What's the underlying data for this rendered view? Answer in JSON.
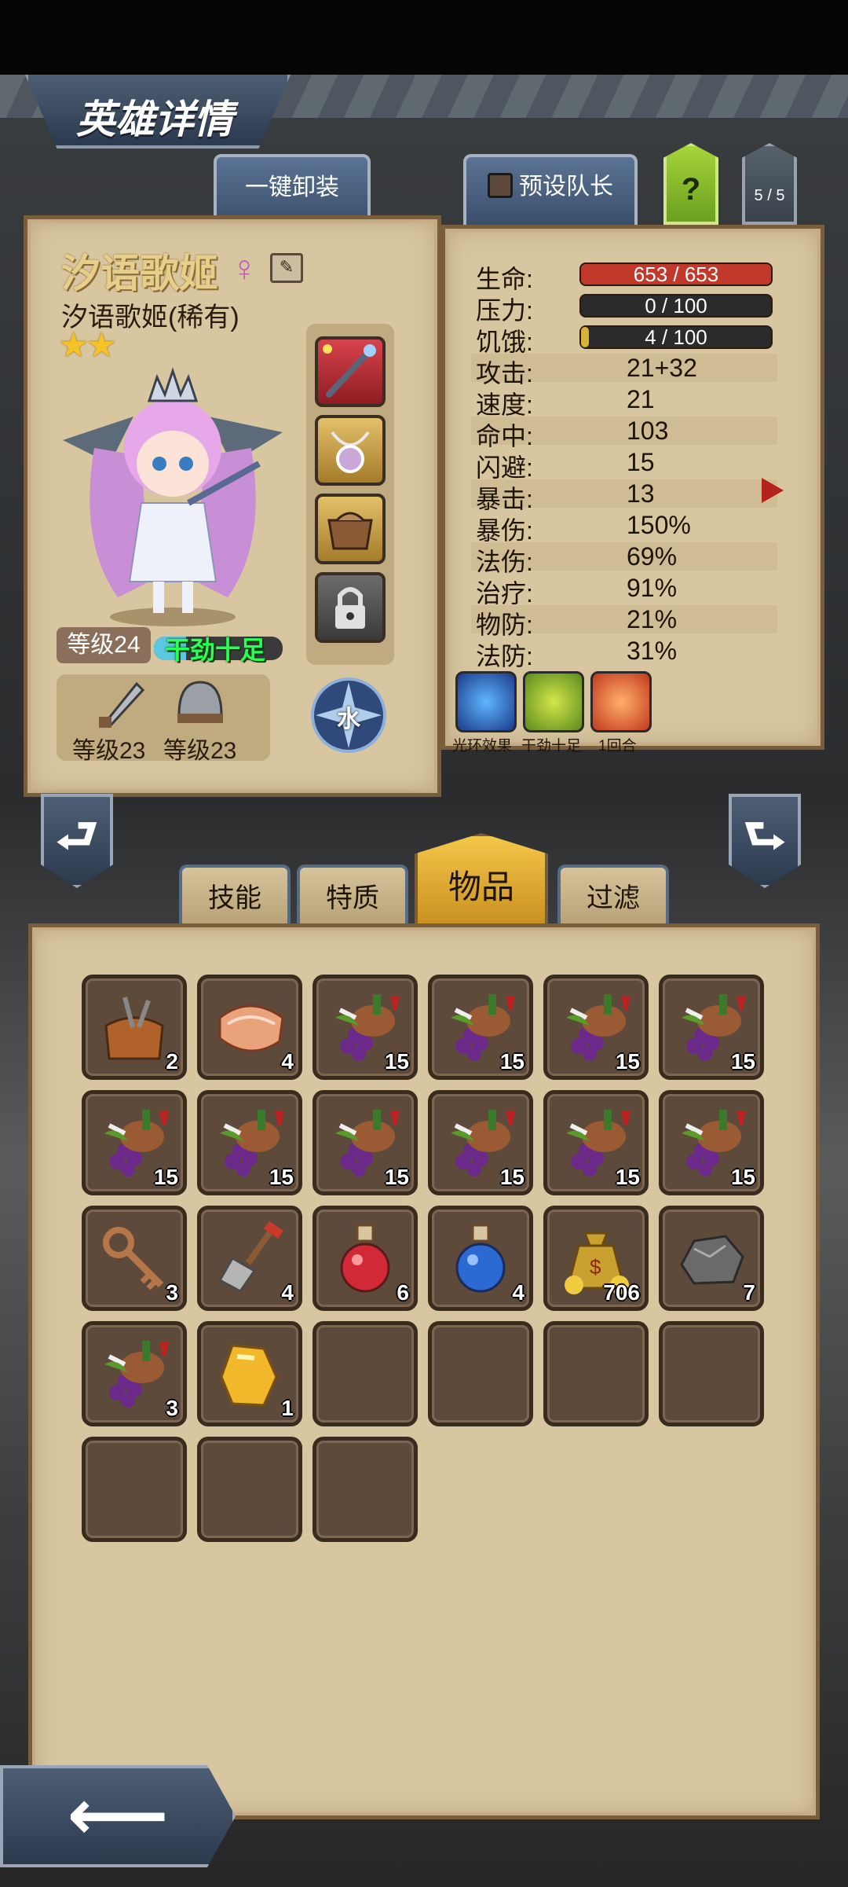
{
  "header": {
    "title": "英雄详情",
    "unequip_all_label": "一键卸装",
    "preset_leader_label": "预设队长",
    "help_label": "?",
    "page_indicator": "5 / 5"
  },
  "hero": {
    "name": "汐语歌姬",
    "gender_symbol": "♀",
    "subtitle": "汐语歌姬(稀有)",
    "stars": "★★",
    "star_count": 2,
    "level_label": "等级24",
    "mood_label": "干劲十足",
    "mood_fill": 0.25,
    "gear": [
      {
        "icon": "sword-icon",
        "level_label": "等级23"
      },
      {
        "icon": "helmet-icon",
        "level_label": "等级23"
      }
    ],
    "element_label": "水",
    "equip_slots": [
      "staff-icon",
      "amulet-icon",
      "bag-icon",
      "lock-icon"
    ]
  },
  "stats": {
    "hp": {
      "label": "生命:",
      "value": "653 / 653",
      "fraction": 1.0,
      "color": "#c0392b"
    },
    "stress": {
      "label": "压力:",
      "value": "0 / 100",
      "fraction": 0.0,
      "color": "#8a6f2a"
    },
    "hunger": {
      "label": "饥饿:",
      "value": "4 / 100",
      "fraction": 0.04,
      "color": "#d8b23a"
    },
    "rows": [
      {
        "label": "攻击:",
        "value": "21+32"
      },
      {
        "label": "速度:",
        "value": "21"
      },
      {
        "label": "命中:",
        "value": "103"
      },
      {
        "label": "闪避:",
        "value": "15"
      },
      {
        "label": "暴击:",
        "value": "13"
      },
      {
        "label": "暴伤:",
        "value": "150%"
      },
      {
        "label": "法伤:",
        "value": "69%"
      },
      {
        "label": "治疗:",
        "value": "91%"
      },
      {
        "label": "物防:",
        "value": "21%"
      },
      {
        "label": "法防:",
        "value": "31%"
      }
    ],
    "buffs": [
      {
        "icon": "skull-aura-icon",
        "label": "光环效果"
      },
      {
        "icon": "motivated-icon",
        "label": "干劲十足"
      },
      {
        "icon": "shield-buff-icon",
        "label": "1回合"
      }
    ]
  },
  "tabs": {
    "skills": "技能",
    "traits": "特质",
    "items": "物品",
    "filter": "过滤"
  },
  "inventory": [
    {
      "icon": "tool-bag-icon",
      "qty": "2"
    },
    {
      "icon": "salmon-steak-icon",
      "qty": "4"
    },
    {
      "icon": "feast-icon",
      "qty": "15"
    },
    {
      "icon": "feast-icon",
      "qty": "15"
    },
    {
      "icon": "feast-icon",
      "qty": "15"
    },
    {
      "icon": "feast-icon",
      "qty": "15"
    },
    {
      "icon": "feast-icon",
      "qty": "15"
    },
    {
      "icon": "feast-icon",
      "qty": "15"
    },
    {
      "icon": "feast-icon",
      "qty": "15"
    },
    {
      "icon": "feast-icon",
      "qty": "15"
    },
    {
      "icon": "feast-icon",
      "qty": "15"
    },
    {
      "icon": "feast-icon",
      "qty": "15"
    },
    {
      "icon": "key-icon",
      "qty": "3"
    },
    {
      "icon": "shovel-icon",
      "qty": "4"
    },
    {
      "icon": "red-potion-icon",
      "qty": "6"
    },
    {
      "icon": "blue-potion-icon",
      "qty": "4"
    },
    {
      "icon": "gold-bag-icon",
      "qty": "706"
    },
    {
      "icon": "ore-icon",
      "qty": "7"
    },
    {
      "icon": "feast-icon",
      "qty": "3"
    },
    {
      "icon": "gold-nugget-icon",
      "qty": "1"
    },
    {
      "icon": "empty-slot",
      "qty": ""
    },
    {
      "icon": "empty-slot",
      "qty": ""
    },
    {
      "icon": "empty-slot",
      "qty": ""
    },
    {
      "icon": "empty-slot",
      "qty": ""
    },
    {
      "icon": "empty-slot",
      "qty": ""
    },
    {
      "icon": "empty-slot",
      "qty": ""
    },
    {
      "icon": "empty-slot",
      "qty": ""
    }
  ]
}
